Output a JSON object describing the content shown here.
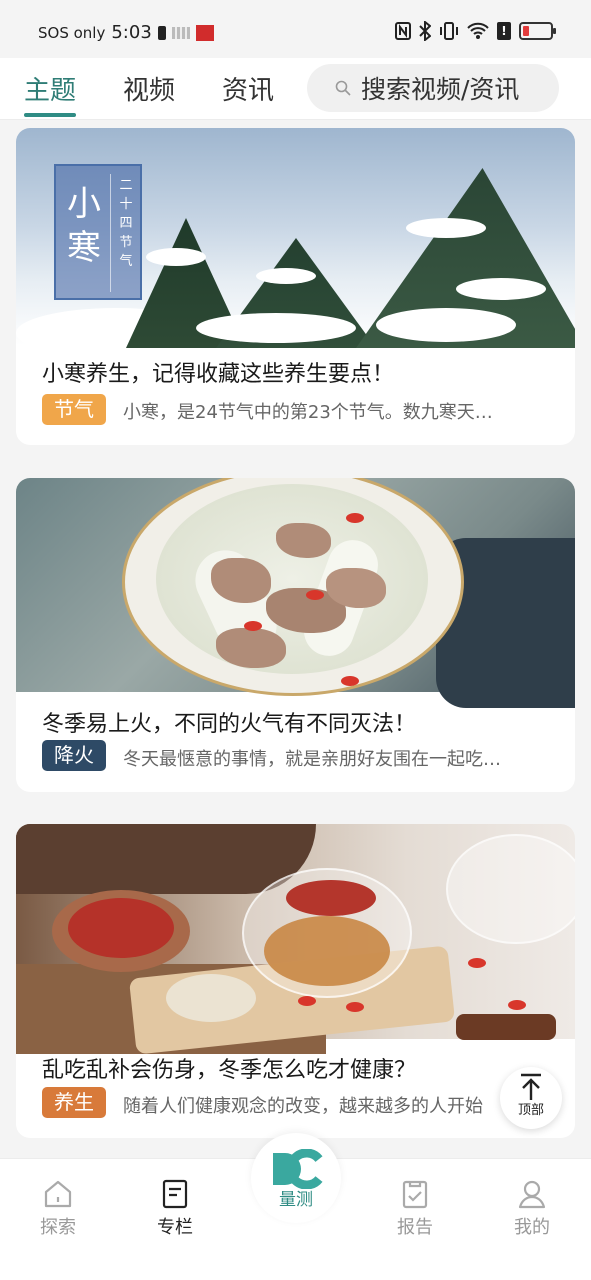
{
  "status_bar": {
    "carrier": "SOS only",
    "time": "5:03"
  },
  "tabs": [
    {
      "label": "主题",
      "active": true
    },
    {
      "label": "视频",
      "active": false
    },
    {
      "label": "资讯",
      "active": false
    }
  ],
  "search": {
    "placeholder": "搜索视频/资讯"
  },
  "cards": [
    {
      "title": "小寒养生，记得收藏这些养生要点！",
      "tag": "节气",
      "tag_color": "#f0a64a",
      "desc": "小寒，是24节气中的第23个节气。数九寒天…",
      "image": {
        "big_text": "小寒",
        "small_text": "二十四节气"
      }
    },
    {
      "title": "冬季易上火，不同的火气有不同灭法！",
      "tag": "降火",
      "tag_color": "#2e4a66",
      "desc": "冬天最惬意的事情，就是亲朋好友围在一起吃…"
    },
    {
      "title": "乱吃乱补会伤身，冬季怎么吃才健康？",
      "tag": "养生",
      "tag_color": "#d87a3a",
      "desc": "随着人们健康观念的改变，越来越多的人开始"
    }
  ],
  "top_button": {
    "label": "顶部"
  },
  "bottom_nav": [
    {
      "label": "探索",
      "icon": "home-icon",
      "active": false
    },
    {
      "label": "专栏",
      "icon": "column-icon",
      "active": true
    },
    {
      "label": "量测",
      "icon": "measure-logo-icon",
      "active": false,
      "center": true
    },
    {
      "label": "报告",
      "icon": "report-icon",
      "active": false
    },
    {
      "label": "我的",
      "icon": "profile-icon",
      "active": false
    }
  ],
  "colors": {
    "accent": "#2f8c84"
  }
}
